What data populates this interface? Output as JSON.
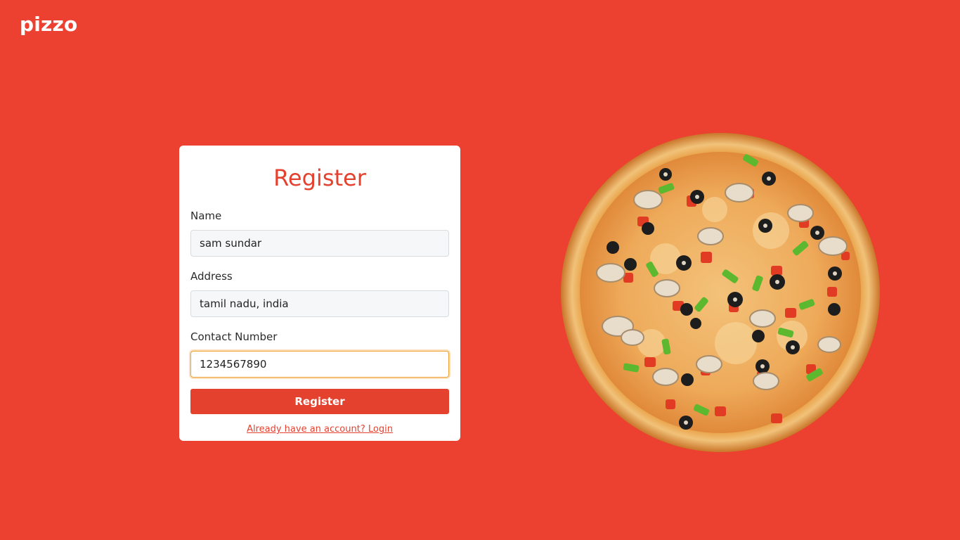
{
  "brand": {
    "name": "pizzo"
  },
  "form": {
    "title": "Register",
    "fields": [
      {
        "label": "Name",
        "value": "sam sundar"
      },
      {
        "label": "Address",
        "value": "tamil nadu, india"
      },
      {
        "label": "Contact Number",
        "value": "1234567890"
      }
    ],
    "submit_label": "Register",
    "login_link": "Already have an account? Login"
  },
  "image": {
    "name": "pizza-image"
  },
  "colors": {
    "background": "#ec4031",
    "accent": "#e5412f",
    "card": "#ffffff",
    "input_bg": "#f6f7f9",
    "focus": "#f0a23a"
  }
}
